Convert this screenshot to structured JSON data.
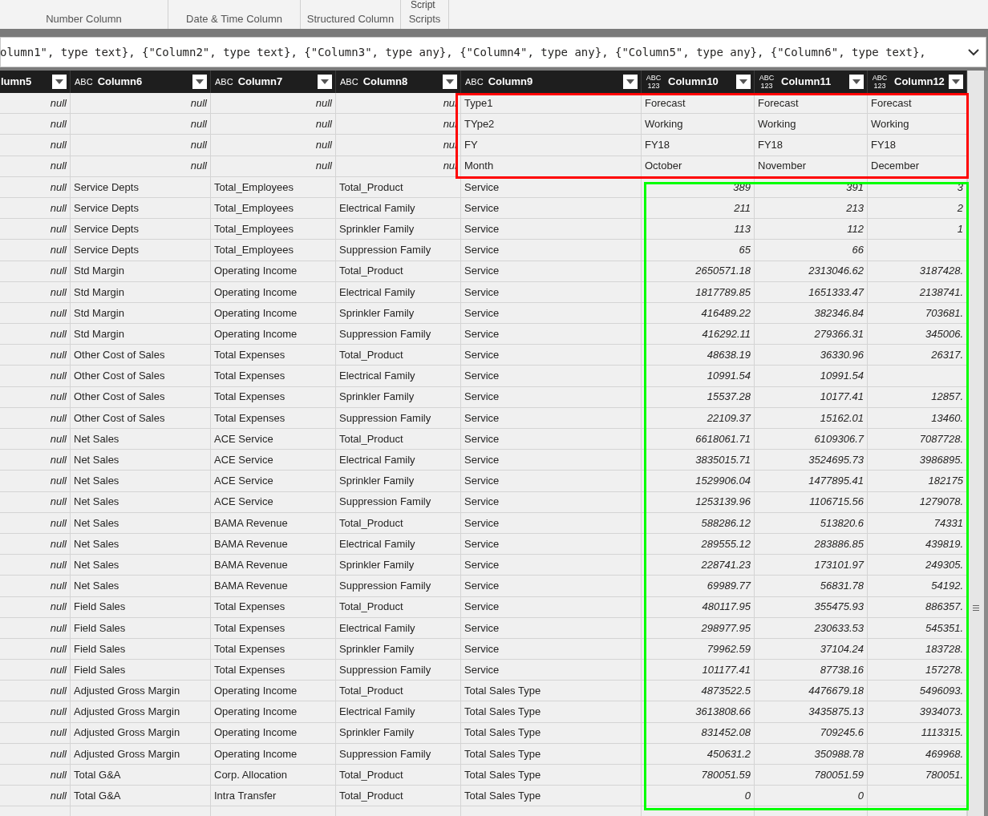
{
  "ribbon": {
    "top_label": "Script",
    "groups": [
      "Number Column",
      "Date & Time Column",
      "Structured Column",
      "Scripts"
    ]
  },
  "formula_bar": {
    "value": "olumn1\", type text}, {\"Column2\", type text}, {\"Column3\", type any}, {\"Column4\", type any}, {\"Column5\", type any}, {\"Column6\", type text},"
  },
  "table": {
    "columns": [
      {
        "name": "lumn5"
      },
      {
        "name": "Column6",
        "type_glyph": "ABC",
        "kind": "text"
      },
      {
        "name": "Column7",
        "type_glyph": "ABC",
        "kind": "text"
      },
      {
        "name": "Column8",
        "type_glyph": "ABC",
        "kind": "text"
      },
      {
        "name": "Column9",
        "type_glyph": "ABC",
        "kind": "text"
      },
      {
        "name": "Column10",
        "type_glyph": "ABC 123",
        "kind": "any"
      },
      {
        "name": "Column11",
        "type_glyph": "ABC 123",
        "kind": "any"
      },
      {
        "name": "Column12",
        "type_glyph": "ABC 123",
        "kind": "any"
      }
    ],
    "rows": [
      {
        "kind": "promoted",
        "cells": [
          "null",
          "null",
          "null",
          "nul",
          "Type1",
          "Forecast",
          "Forecast",
          "Forecast"
        ]
      },
      {
        "kind": "promoted",
        "cells": [
          "null",
          "null",
          "null",
          "nul",
          "TYpe2",
          "Working",
          "Working",
          "Working"
        ]
      },
      {
        "kind": "promoted",
        "cells": [
          "null",
          "null",
          "null",
          "nul",
          "FY",
          "FY18",
          "FY18",
          "FY18"
        ]
      },
      {
        "kind": "promoted",
        "cells": [
          "null",
          "null",
          "null",
          "nul",
          "Month",
          "October",
          "November",
          "December"
        ]
      },
      {
        "kind": "data",
        "cells": [
          "null",
          "Service Depts",
          "Total_Employees",
          "Total_Product",
          "Service",
          "389",
          "391",
          "3"
        ]
      },
      {
        "kind": "data",
        "cells": [
          "null",
          "Service Depts",
          "Total_Employees",
          "Electrical Family",
          "Service",
          "211",
          "213",
          "2"
        ]
      },
      {
        "kind": "data",
        "cells": [
          "null",
          "Service Depts",
          "Total_Employees",
          "Sprinkler Family",
          "Service",
          "113",
          "112",
          "1"
        ]
      },
      {
        "kind": "data",
        "cells": [
          "null",
          "Service Depts",
          "Total_Employees",
          "Suppression Family",
          "Service",
          "65",
          "66",
          ""
        ]
      },
      {
        "kind": "data",
        "cells": [
          "null",
          "Std Margin",
          "Operating Income",
          "Total_Product",
          "Service",
          "2650571.18",
          "2313046.62",
          "3187428."
        ]
      },
      {
        "kind": "data",
        "cells": [
          "null",
          "Std Margin",
          "Operating Income",
          "Electrical Family",
          "Service",
          "1817789.85",
          "1651333.47",
          "2138741."
        ]
      },
      {
        "kind": "data",
        "cells": [
          "null",
          "Std Margin",
          "Operating Income",
          "Sprinkler Family",
          "Service",
          "416489.22",
          "382346.84",
          "703681."
        ]
      },
      {
        "kind": "data",
        "cells": [
          "null",
          "Std Margin",
          "Operating Income",
          "Suppression Family",
          "Service",
          "416292.11",
          "279366.31",
          "345006."
        ]
      },
      {
        "kind": "data",
        "cells": [
          "null",
          "Other Cost of Sales",
          "Total Expenses",
          "Total_Product",
          "Service",
          "48638.19",
          "36330.96",
          "26317."
        ]
      },
      {
        "kind": "data",
        "cells": [
          "null",
          "Other Cost of Sales",
          "Total Expenses",
          "Electrical Family",
          "Service",
          "10991.54",
          "10991.54",
          ""
        ]
      },
      {
        "kind": "data",
        "cells": [
          "null",
          "Other Cost of Sales",
          "Total Expenses",
          "Sprinkler Family",
          "Service",
          "15537.28",
          "10177.41",
          "12857."
        ]
      },
      {
        "kind": "data",
        "cells": [
          "null",
          "Other Cost of Sales",
          "Total Expenses",
          "Suppression Family",
          "Service",
          "22109.37",
          "15162.01",
          "13460."
        ]
      },
      {
        "kind": "data",
        "cells": [
          "null",
          "Net Sales",
          "ACE Service",
          "Total_Product",
          "Service",
          "6618061.71",
          "6109306.7",
          "7087728."
        ]
      },
      {
        "kind": "data",
        "cells": [
          "null",
          "Net Sales",
          "ACE Service",
          "Electrical Family",
          "Service",
          "3835015.71",
          "3524695.73",
          "3986895."
        ]
      },
      {
        "kind": "data",
        "cells": [
          "null",
          "Net Sales",
          "ACE Service",
          "Sprinkler Family",
          "Service",
          "1529906.04",
          "1477895.41",
          "182175"
        ]
      },
      {
        "kind": "data",
        "cells": [
          "null",
          "Net Sales",
          "ACE Service",
          "Suppression Family",
          "Service",
          "1253139.96",
          "1106715.56",
          "1279078."
        ]
      },
      {
        "kind": "data",
        "cells": [
          "null",
          "Net Sales",
          "BAMA Revenue",
          "Total_Product",
          "Service",
          "588286.12",
          "513820.6",
          "74331"
        ]
      },
      {
        "kind": "data",
        "cells": [
          "null",
          "Net Sales",
          "BAMA Revenue",
          "Electrical Family",
          "Service",
          "289555.12",
          "283886.85",
          "439819."
        ]
      },
      {
        "kind": "data",
        "cells": [
          "null",
          "Net Sales",
          "BAMA Revenue",
          "Sprinkler Family",
          "Service",
          "228741.23",
          "173101.97",
          "249305."
        ]
      },
      {
        "kind": "data",
        "cells": [
          "null",
          "Net Sales",
          "BAMA Revenue",
          "Suppression Family",
          "Service",
          "69989.77",
          "56831.78",
          "54192."
        ]
      },
      {
        "kind": "data",
        "cells": [
          "null",
          "Field Sales",
          "Total Expenses",
          "Total_Product",
          "Service",
          "480117.95",
          "355475.93",
          "886357."
        ]
      },
      {
        "kind": "data",
        "cells": [
          "null",
          "Field Sales",
          "Total Expenses",
          "Electrical Family",
          "Service",
          "298977.95",
          "230633.53",
          "545351."
        ]
      },
      {
        "kind": "data",
        "cells": [
          "null",
          "Field Sales",
          "Total Expenses",
          "Sprinkler Family",
          "Service",
          "79962.59",
          "37104.24",
          "183728."
        ]
      },
      {
        "kind": "data",
        "cells": [
          "null",
          "Field Sales",
          "Total Expenses",
          "Suppression Family",
          "Service",
          "101177.41",
          "87738.16",
          "157278."
        ]
      },
      {
        "kind": "data",
        "cells": [
          "null",
          "Adjusted Gross Margin",
          "Operating Income",
          "Total_Product",
          "Total Sales Type",
          "4873522.5",
          "4476679.18",
          "5496093."
        ]
      },
      {
        "kind": "data",
        "cells": [
          "null",
          "Adjusted Gross Margin",
          "Operating Income",
          "Electrical Family",
          "Total Sales Type",
          "3613808.66",
          "3435875.13",
          "3934073."
        ]
      },
      {
        "kind": "data",
        "cells": [
          "null",
          "Adjusted Gross Margin",
          "Operating Income",
          "Sprinkler Family",
          "Total Sales Type",
          "831452.08",
          "709245.6",
          "1113315."
        ]
      },
      {
        "kind": "data",
        "cells": [
          "null",
          "Adjusted Gross Margin",
          "Operating Income",
          "Suppression Family",
          "Total Sales Type",
          "450631.2",
          "350988.78",
          "469968."
        ]
      },
      {
        "kind": "data",
        "cells": [
          "null",
          "Total G&A",
          "Corp. Allocation",
          "Total_Product",
          "Total Sales Type",
          "780051.59",
          "780051.59",
          "780051."
        ]
      },
      {
        "kind": "data",
        "cells": [
          "null",
          "Total G&A",
          "Intra Transfer",
          "Total_Product",
          "Total Sales Type",
          "0",
          "0",
          ""
        ]
      }
    ]
  },
  "highlights": [
    {
      "kind": "header-rows",
      "color": "#ff0000"
    },
    {
      "kind": "values",
      "color": "#00ff00"
    }
  ]
}
